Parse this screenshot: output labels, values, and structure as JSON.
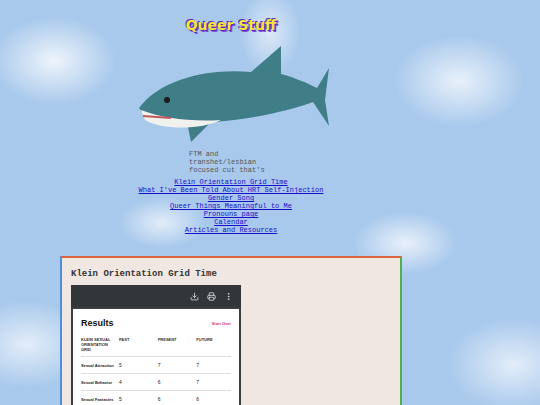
{
  "site": {
    "title": "Queer Stuff",
    "description": "FTM and transhet/lesbian focused cut that's"
  },
  "nav": [
    {
      "label": "Klein Orientation Grid Time"
    },
    {
      "label": "What I've Been Told About HRT Self-Injection"
    },
    {
      "label": "Gender Song"
    },
    {
      "label": "Queer Things Meaningful to Me"
    },
    {
      "label": "Pronouns page"
    },
    {
      "label": "Calendar"
    },
    {
      "label": "Articles and Resources"
    }
  ],
  "panel": {
    "heading": "Klein Orientation Grid Time",
    "document": {
      "title": "Results",
      "action": "Start Over",
      "columns": [
        "KLEIN SEXUAL ORIENTATION GRID",
        "PAST",
        "PRESENT",
        "FUTURE"
      ],
      "rows": [
        {
          "label": "Sexual Attraction",
          "values": [
            "5",
            "7",
            "7"
          ]
        },
        {
          "label": "Sexual Behavior",
          "values": [
            "4",
            "6",
            "7"
          ]
        },
        {
          "label": "Sexual Fantasies",
          "values": [
            "5",
            "6",
            "6"
          ]
        }
      ]
    }
  }
}
